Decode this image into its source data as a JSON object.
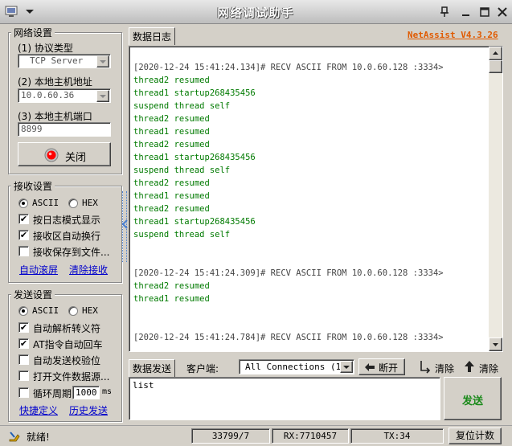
{
  "window": {
    "title": "网络调试助手",
    "brand": "NetAssist V4.3.26"
  },
  "network": {
    "group_title": "网络设置",
    "protocol_label": "(1) 协议类型",
    "protocol_value": "TCP Server",
    "host_label": "(2) 本地主机地址",
    "host_value": "10.0.60.36",
    "port_label": "(3) 本地主机端口",
    "port_value": "8899",
    "close_button": "关闭"
  },
  "receive": {
    "group_title": "接收设置",
    "ascii": "ASCII",
    "hex": "HEX",
    "opt_log_mode": "按日志模式显示",
    "opt_auto_wrap": "接收区自动换行",
    "opt_save_file": "接收保存到文件...",
    "link_auto_scroll": "自动滚屏",
    "link_clear": "清除接收"
  },
  "send": {
    "group_title": "发送设置",
    "ascii": "ASCII",
    "hex": "HEX",
    "opt_escape": "自动解析转义符",
    "opt_at": "AT指令自动回车",
    "opt_checksum": "自动发送校验位",
    "opt_open_file": "打开文件数据源...",
    "opt_cycle": "循环周期",
    "cycle_value": "1000",
    "cycle_unit": "ms",
    "link_shortcut": "快捷定义",
    "link_history": "历史发送"
  },
  "log": {
    "tab_label": "数据日志",
    "lines": [
      {
        "type": "head",
        "text": "[2020-12-24 15:41:24.134]# RECV ASCII FROM 10.0.60.128 :3334>"
      },
      {
        "type": "data",
        "text": "thread2 resumed"
      },
      {
        "type": "data",
        "text": "thread1 startup268435456"
      },
      {
        "type": "data",
        "text": "suspend thread self"
      },
      {
        "type": "data",
        "text": "thread2 resumed"
      },
      {
        "type": "data",
        "text": "thread1 resumed"
      },
      {
        "type": "data",
        "text": "thread2 resumed"
      },
      {
        "type": "data",
        "text": "thread1 startup268435456"
      },
      {
        "type": "data",
        "text": "suspend thread self"
      },
      {
        "type": "data",
        "text": "thread2 resumed"
      },
      {
        "type": "data",
        "text": "thread1 resumed"
      },
      {
        "type": "data",
        "text": "thread2 resumed"
      },
      {
        "type": "data",
        "text": "thread1 startup268435456"
      },
      {
        "type": "data",
        "text": "suspend thread self"
      },
      {
        "type": "blank",
        "text": ""
      },
      {
        "type": "blank",
        "text": ""
      },
      {
        "type": "head",
        "text": "[2020-12-24 15:41:24.309]# RECV ASCII FROM 10.0.60.128 :3334>"
      },
      {
        "type": "data",
        "text": "thread2 resumed"
      },
      {
        "type": "data",
        "text": "thread1 resumed"
      },
      {
        "type": "blank",
        "text": ""
      },
      {
        "type": "blank",
        "text": ""
      },
      {
        "type": "head",
        "text": "[2020-12-24 15:41:24.784]# RECV ASCII FROM 10.0.60.128 :3334>"
      }
    ]
  },
  "sendbar": {
    "tab_label": "数据发送",
    "client_label": "客户端:",
    "client_select": "All Connections (1)",
    "disconnect": "断开",
    "clear1": "清除",
    "clear2": "清除",
    "input_value": "list",
    "send_button": "发送"
  },
  "status": {
    "ready": "就绪!",
    "counter": "33799/7",
    "rx": "RX:7710457",
    "tx": "TX:34",
    "reset": "复位计数"
  },
  "colors": {
    "brand": "#e05a00",
    "log_data": "#007a00",
    "send_btn_text": "#1a8a1a",
    "close_led": "#ff0000"
  }
}
